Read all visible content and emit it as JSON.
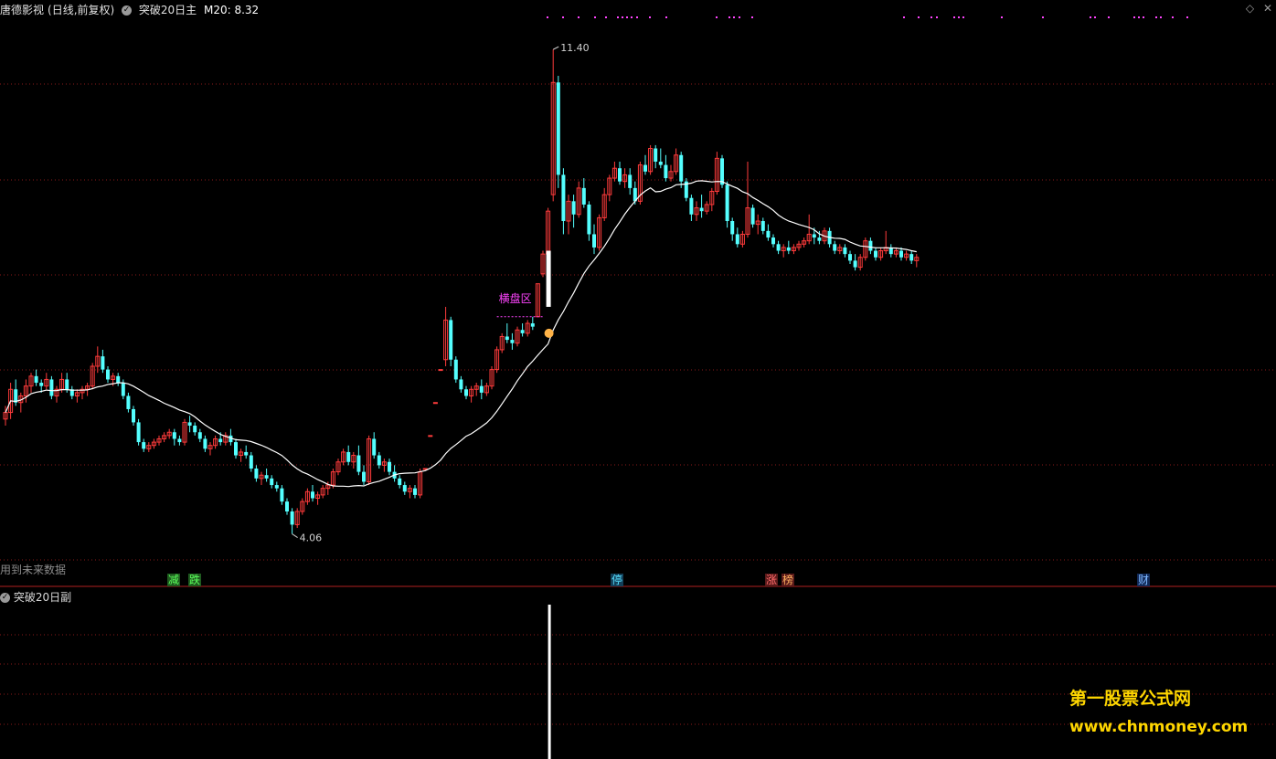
{
  "header": {
    "stock_name": "唐德影视",
    "period": "(日线,前复权)",
    "indicator": "突破20日主",
    "ma_label": "M20: 8.32"
  },
  "top_icons": {
    "diamond": "◇",
    "close": "✕"
  },
  "future_note": "用到未来数据",
  "badges": [
    {
      "text": "减",
      "bg": "#1f5a1f",
      "fg": "#5bff5b"
    },
    {
      "text": "跌",
      "bg": "#1f5a1f",
      "fg": "#5bff5b"
    },
    {
      "text": "停",
      "bg": "#123f58",
      "fg": "#58e0ff"
    },
    {
      "text": "涨",
      "bg": "#5a1a1a",
      "fg": "#ff6b6b"
    },
    {
      "text": "榜",
      "bg": "#5a1a1a",
      "fg": "#ffb060"
    },
    {
      "text": "财",
      "bg": "#122a58",
      "fg": "#7fb8ff"
    }
  ],
  "sub_panel": {
    "title": "突破20日副"
  },
  "watermark": {
    "line1": "第一股票公式网",
    "line2": "www.chnmoney.com"
  },
  "colors": {
    "up": "#ff3b3b",
    "down": "#54ffff",
    "ma": "#ffffff",
    "grid": "#8a1a1a",
    "signal": "#ffffff",
    "annotation": "#ff44ff",
    "dots": "#ff44ff"
  },
  "chart_data": {
    "type": "candlestick",
    "title": "",
    "ylim": [
      3.5,
      11.9
    ],
    "max_label": "11.40",
    "min_label": "4.06",
    "zone_label": "横盘区",
    "ma_name": "M20",
    "ma_period": 20,
    "ohlc": [
      [
        5.8,
        6.0,
        5.7,
        5.9
      ],
      [
        5.9,
        6.35,
        5.8,
        6.25
      ],
      [
        6.25,
        6.4,
        6.0,
        6.05
      ],
      [
        6.05,
        6.2,
        5.9,
        6.15
      ],
      [
        6.15,
        6.4,
        6.05,
        6.3
      ],
      [
        6.3,
        6.5,
        6.2,
        6.45
      ],
      [
        6.45,
        6.55,
        6.3,
        6.35
      ],
      [
        6.35,
        6.4,
        6.2,
        6.3
      ],
      [
        6.3,
        6.5,
        6.25,
        6.4
      ],
      [
        6.4,
        6.45,
        6.1,
        6.15
      ],
      [
        6.15,
        6.3,
        6.05,
        6.25
      ],
      [
        6.25,
        6.5,
        6.2,
        6.4
      ],
      [
        6.4,
        6.5,
        6.2,
        6.25
      ],
      [
        6.25,
        6.3,
        6.1,
        6.15
      ],
      [
        6.15,
        6.25,
        6.05,
        6.2
      ],
      [
        6.2,
        6.3,
        6.1,
        6.25
      ],
      [
        6.25,
        6.35,
        6.15,
        6.3
      ],
      [
        6.3,
        6.65,
        6.25,
        6.6
      ],
      [
        6.6,
        6.9,
        6.5,
        6.75
      ],
      [
        6.75,
        6.85,
        6.5,
        6.55
      ],
      [
        6.55,
        6.6,
        6.35,
        6.4
      ],
      [
        6.4,
        6.5,
        6.3,
        6.45
      ],
      [
        6.45,
        6.5,
        6.3,
        6.35
      ],
      [
        6.35,
        6.4,
        6.1,
        6.15
      ],
      [
        6.15,
        6.2,
        5.9,
        5.95
      ],
      [
        5.95,
        6.0,
        5.7,
        5.75
      ],
      [
        5.75,
        5.8,
        5.4,
        5.45
      ],
      [
        5.45,
        5.5,
        5.3,
        5.35
      ],
      [
        5.35,
        5.45,
        5.3,
        5.4
      ],
      [
        5.4,
        5.5,
        5.35,
        5.45
      ],
      [
        5.45,
        5.55,
        5.4,
        5.5
      ],
      [
        5.5,
        5.6,
        5.45,
        5.55
      ],
      [
        5.55,
        5.65,
        5.5,
        5.6
      ],
      [
        5.6,
        5.65,
        5.4,
        5.5
      ],
      [
        5.5,
        5.55,
        5.4,
        5.45
      ],
      [
        5.45,
        5.8,
        5.4,
        5.75
      ],
      [
        5.75,
        5.85,
        5.6,
        5.7
      ],
      [
        5.7,
        5.75,
        5.55,
        5.6
      ],
      [
        5.6,
        5.65,
        5.45,
        5.5
      ],
      [
        5.5,
        5.55,
        5.3,
        5.35
      ],
      [
        5.35,
        5.45,
        5.25,
        5.4
      ],
      [
        5.4,
        5.55,
        5.35,
        5.5
      ],
      [
        5.5,
        5.6,
        5.4,
        5.45
      ],
      [
        5.45,
        5.6,
        5.4,
        5.55
      ],
      [
        5.55,
        5.65,
        5.4,
        5.45
      ],
      [
        5.45,
        5.5,
        5.2,
        5.25
      ],
      [
        5.25,
        5.35,
        5.15,
        5.3
      ],
      [
        5.3,
        5.4,
        5.2,
        5.25
      ],
      [
        5.25,
        5.3,
        5.0,
        5.05
      ],
      [
        5.05,
        5.1,
        4.85,
        4.9
      ],
      [
        4.9,
        5.0,
        4.8,
        4.95
      ],
      [
        4.95,
        5.05,
        4.85,
        4.9
      ],
      [
        4.9,
        4.95,
        4.75,
        4.8
      ],
      [
        4.8,
        4.85,
        4.7,
        4.75
      ],
      [
        4.75,
        4.8,
        4.5,
        4.55
      ],
      [
        4.55,
        4.6,
        4.35,
        4.4
      ],
      [
        4.4,
        4.45,
        4.06,
        4.2
      ],
      [
        4.2,
        4.45,
        4.15,
        4.4
      ],
      [
        4.4,
        4.6,
        4.35,
        4.55
      ],
      [
        4.55,
        4.75,
        4.5,
        4.7
      ],
      [
        4.7,
        4.8,
        4.55,
        4.6
      ],
      [
        4.6,
        4.7,
        4.5,
        4.65
      ],
      [
        4.65,
        4.8,
        4.6,
        4.75
      ],
      [
        4.75,
        4.85,
        4.65,
        4.8
      ],
      [
        4.8,
        5.05,
        4.75,
        5.0
      ],
      [
        5.0,
        5.2,
        4.95,
        5.15
      ],
      [
        5.15,
        5.35,
        5.1,
        5.3
      ],
      [
        5.3,
        5.4,
        5.1,
        5.15
      ],
      [
        5.15,
        5.3,
        5.05,
        5.25
      ],
      [
        5.25,
        5.4,
        4.95,
        5.0
      ],
      [
        5.0,
        5.1,
        4.8,
        4.85
      ],
      [
        4.85,
        5.55,
        4.8,
        5.5
      ],
      [
        5.5,
        5.6,
        5.2,
        5.25
      ],
      [
        5.25,
        5.3,
        5.05,
        5.1
      ],
      [
        5.1,
        5.2,
        5.0,
        5.15
      ],
      [
        5.15,
        5.2,
        4.95,
        5.0
      ],
      [
        5.0,
        5.1,
        4.85,
        4.9
      ],
      [
        4.9,
        4.95,
        4.75,
        4.8
      ],
      [
        4.8,
        4.85,
        4.65,
        4.7
      ],
      [
        4.7,
        4.8,
        4.6,
        4.75
      ],
      [
        4.75,
        4.8,
        4.6,
        4.65
      ],
      [
        4.65,
        5.05,
        4.6,
        5.0
      ],
      [
        5.05,
        5.05,
        5.05,
        5.05
      ],
      [
        5.55,
        5.55,
        5.55,
        5.55
      ],
      [
        6.05,
        6.05,
        6.05,
        6.05
      ],
      [
        6.55,
        6.55,
        6.55,
        6.55
      ],
      [
        6.7,
        7.5,
        6.6,
        7.3
      ],
      [
        7.3,
        7.35,
        6.6,
        6.7
      ],
      [
        6.7,
        6.75,
        6.35,
        6.4
      ],
      [
        6.4,
        6.45,
        6.2,
        6.25
      ],
      [
        6.25,
        6.3,
        6.1,
        6.15
      ],
      [
        6.15,
        6.3,
        6.05,
        6.25
      ],
      [
        6.25,
        6.35,
        6.15,
        6.3
      ],
      [
        6.3,
        6.4,
        6.1,
        6.2
      ],
      [
        6.2,
        6.35,
        6.15,
        6.3
      ],
      [
        6.3,
        6.6,
        6.25,
        6.55
      ],
      [
        6.55,
        6.9,
        6.5,
        6.85
      ],
      [
        6.85,
        7.1,
        6.8,
        7.05
      ],
      [
        7.05,
        7.25,
        6.95,
        7.0
      ],
      [
        7.0,
        7.1,
        6.85,
        6.95
      ],
      [
        6.95,
        7.2,
        6.9,
        7.15
      ],
      [
        7.15,
        7.25,
        7.05,
        7.1
      ],
      [
        7.1,
        7.3,
        7.05,
        7.25
      ],
      [
        7.25,
        7.35,
        7.15,
        7.2
      ],
      [
        7.35,
        7.85,
        7.35,
        7.85
      ],
      [
        8.0,
        8.35,
        7.95,
        8.3
      ],
      [
        8.3,
        9.0,
        8.25,
        8.95
      ],
      [
        9.2,
        11.4,
        9.1,
        10.9
      ],
      [
        10.9,
        11.0,
        9.3,
        9.5
      ],
      [
        9.5,
        9.6,
        8.6,
        8.8
      ],
      [
        8.8,
        9.2,
        8.6,
        9.1
      ],
      [
        9.1,
        9.2,
        8.7,
        8.9
      ],
      [
        8.9,
        9.4,
        8.85,
        9.3
      ],
      [
        9.3,
        9.45,
        9.0,
        9.05
      ],
      [
        9.05,
        9.1,
        8.5,
        8.6
      ],
      [
        8.6,
        8.75,
        8.3,
        8.4
      ],
      [
        8.4,
        8.9,
        8.35,
        8.85
      ],
      [
        8.85,
        9.3,
        8.8,
        9.2
      ],
      [
        9.2,
        9.5,
        9.1,
        9.45
      ],
      [
        9.45,
        9.7,
        9.4,
        9.6
      ],
      [
        9.6,
        9.7,
        9.35,
        9.4
      ],
      [
        9.4,
        9.6,
        9.3,
        9.5
      ],
      [
        9.5,
        9.6,
        9.2,
        9.3
      ],
      [
        9.3,
        9.4,
        9.05,
        9.1
      ],
      [
        9.1,
        9.7,
        9.05,
        9.65
      ],
      [
        9.65,
        9.8,
        9.5,
        9.55
      ],
      [
        9.55,
        9.95,
        9.5,
        9.9
      ],
      [
        9.9,
        9.95,
        9.6,
        9.7
      ],
      [
        9.7,
        9.9,
        9.6,
        9.65
      ],
      [
        9.65,
        9.8,
        9.4,
        9.45
      ],
      [
        9.45,
        9.65,
        9.4,
        9.55
      ],
      [
        9.55,
        9.9,
        9.5,
        9.8
      ],
      [
        9.8,
        9.85,
        9.3,
        9.4
      ],
      [
        9.4,
        9.45,
        9.1,
        9.15
      ],
      [
        9.15,
        9.2,
        8.8,
        8.9
      ],
      [
        8.9,
        9.1,
        8.8,
        9.0
      ],
      [
        9.0,
        9.2,
        8.85,
        8.95
      ],
      [
        8.95,
        9.1,
        8.9,
        9.05
      ],
      [
        9.05,
        9.3,
        8.95,
        9.25
      ],
      [
        9.25,
        9.85,
        9.2,
        9.75
      ],
      [
        9.75,
        9.8,
        9.3,
        9.35
      ],
      [
        9.35,
        9.4,
        8.7,
        8.8
      ],
      [
        8.8,
        8.85,
        8.5,
        8.6
      ],
      [
        8.6,
        8.7,
        8.4,
        8.45
      ],
      [
        8.45,
        8.65,
        8.4,
        8.6
      ],
      [
        8.6,
        9.7,
        8.55,
        9.0
      ],
      [
        9.0,
        9.05,
        8.7,
        8.75
      ],
      [
        8.75,
        8.9,
        8.6,
        8.8
      ],
      [
        8.8,
        8.85,
        8.6,
        8.65
      ],
      [
        8.65,
        8.75,
        8.5,
        8.55
      ],
      [
        8.55,
        8.6,
        8.4,
        8.45
      ],
      [
        8.45,
        8.5,
        8.3,
        8.35
      ],
      [
        8.35,
        8.45,
        8.25,
        8.4
      ],
      [
        8.4,
        8.5,
        8.3,
        8.35
      ],
      [
        8.35,
        8.45,
        8.3,
        8.4
      ],
      [
        8.4,
        8.5,
        8.35,
        8.45
      ],
      [
        8.45,
        8.55,
        8.4,
        8.5
      ],
      [
        8.5,
        8.9,
        8.45,
        8.6
      ],
      [
        8.6,
        8.7,
        8.45,
        8.55
      ],
      [
        8.55,
        8.65,
        8.45,
        8.5
      ],
      [
        8.5,
        8.7,
        8.45,
        8.65
      ],
      [
        8.65,
        8.7,
        8.4,
        8.45
      ],
      [
        8.45,
        8.5,
        8.3,
        8.35
      ],
      [
        8.35,
        8.45,
        8.3,
        8.4
      ],
      [
        8.4,
        8.45,
        8.25,
        8.3
      ],
      [
        8.3,
        8.35,
        8.15,
        8.2
      ],
      [
        8.2,
        8.3,
        8.05,
        8.1
      ],
      [
        8.1,
        8.3,
        8.05,
        8.25
      ],
      [
        8.25,
        8.55,
        8.2,
        8.5
      ],
      [
        8.5,
        8.55,
        8.3,
        8.35
      ],
      [
        8.35,
        8.4,
        8.2,
        8.25
      ],
      [
        8.25,
        8.4,
        8.2,
        8.35
      ],
      [
        8.35,
        8.65,
        8.3,
        8.4
      ],
      [
        8.4,
        8.45,
        8.25,
        8.3
      ],
      [
        8.3,
        8.4,
        8.25,
        8.35
      ],
      [
        8.35,
        8.4,
        8.2,
        8.25
      ],
      [
        8.25,
        8.35,
        8.2,
        8.3
      ],
      [
        8.3,
        8.35,
        8.15,
        8.2
      ],
      [
        8.2,
        8.3,
        8.1,
        8.25
      ]
    ],
    "sub_signal_index": 106
  }
}
